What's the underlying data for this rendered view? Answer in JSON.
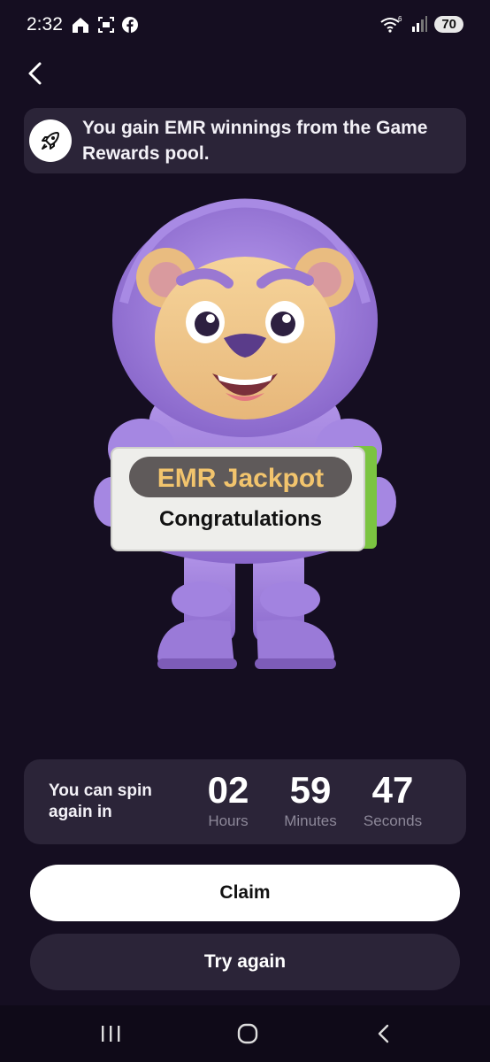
{
  "status_bar": {
    "time": "2:32",
    "battery": "70",
    "left_icons": [
      "home-icon",
      "screenshot-icon",
      "facebook-icon"
    ],
    "right_icons": [
      "wifi-icon",
      "signal-icon",
      "battery-icon"
    ],
    "wifi_generation": "6"
  },
  "header": {
    "back_icon": "chevron-left-icon"
  },
  "banner": {
    "icon": "rocket-icon",
    "text": "You gain EMR winnings from the Game Rewards pool."
  },
  "sign": {
    "title": "EMR Jackpot",
    "subtitle": "Congratulations"
  },
  "timer": {
    "label": "You can spin again in",
    "hours_value": "02",
    "hours_label": "Hours",
    "minutes_value": "59",
    "minutes_label": "Minutes",
    "seconds_value": "47",
    "seconds_label": "Seconds"
  },
  "buttons": {
    "claim": "Claim",
    "try_again": "Try again"
  },
  "nav_bar": {
    "items": [
      "recent-apps-icon",
      "home-circle-icon",
      "back-chevron-icon"
    ]
  },
  "colors": {
    "background": "#150e21",
    "card": "#2b2438",
    "sign_title": "#f2c46d",
    "mascot_purple": "#9b7ad8"
  }
}
